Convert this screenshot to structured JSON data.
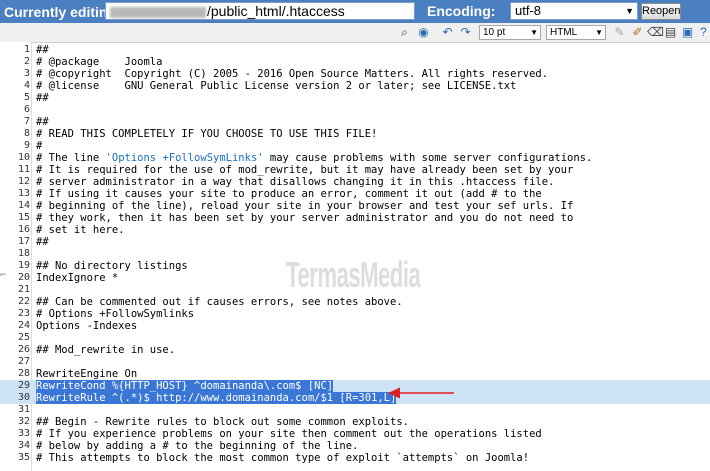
{
  "header": {
    "editing_label": "Currently editing:",
    "path_value": "/public_html/.htaccess",
    "encoding_label": "Encoding:",
    "encoding_value": "utf-8",
    "reopen_label": "Reopen"
  },
  "toolbar": {
    "font_size_value": "10 pt",
    "syntax_value": "HTML"
  },
  "watermark": "TermasMedia",
  "editor": {
    "lines": [
      {
        "n": "1",
        "code": "##"
      },
      {
        "n": "2",
        "code": "# @package    Joomla"
      },
      {
        "n": "3",
        "code": "# @copyright  Copyright (C) 2005 - 2016 Open Source Matters. All rights reserved."
      },
      {
        "n": "4",
        "code": "# @license    GNU General Public License version 2 or later; see LICENSE.txt"
      },
      {
        "n": "5",
        "code": "##"
      },
      {
        "n": "6",
        "code": ""
      },
      {
        "n": "7",
        "code": "##"
      },
      {
        "n": "8",
        "code": "# READ THIS COMPLETELY IF YOU CHOOSE TO USE THIS FILE!"
      },
      {
        "n": "9",
        "code": "#"
      },
      {
        "n": "10",
        "code": "# The line ",
        "str": "'Options +FollowSymLinks'",
        "rest": " may cause problems with some server configurations."
      },
      {
        "n": "11",
        "code": "# It is required for the use of mod_rewrite, but it may have already been set by your"
      },
      {
        "n": "12",
        "code": "# server administrator in a way that disallows changing it in this .htaccess file."
      },
      {
        "n": "13",
        "code": "# If using it causes your site to produce an error, comment it out (add # to the"
      },
      {
        "n": "14",
        "code": "# beginning of the line), reload your site in your browser and test your sef urls. If"
      },
      {
        "n": "15",
        "code": "# they work, then it has been set by your server administrator and you do not need to"
      },
      {
        "n": "16",
        "code": "# set it here."
      },
      {
        "n": "17",
        "code": "##"
      },
      {
        "n": "18",
        "code": ""
      },
      {
        "n": "19",
        "code": "## No directory listings"
      },
      {
        "n": "20",
        "code": "IndexIgnore *"
      },
      {
        "n": "21",
        "code": ""
      },
      {
        "n": "22",
        "code": "## Can be commented out if causes errors, see notes above."
      },
      {
        "n": "23",
        "code": "# Options +FollowSymlinks"
      },
      {
        "n": "24",
        "code": "Options -Indexes"
      },
      {
        "n": "25",
        "code": ""
      },
      {
        "n": "26",
        "code": "## Mod_rewrite in use."
      },
      {
        "n": "27",
        "code": ""
      },
      {
        "n": "28",
        "code": "RewriteEngine On"
      },
      {
        "n": "29",
        "code": "RewriteCond %{HTTP_HOST} ^domainanda\\.com$ [NC]",
        "selected": true
      },
      {
        "n": "30",
        "code": "RewriteRule ^(.*)$ http://www.domainanda.com/$1 [R=301,L]",
        "selected": true
      },
      {
        "n": "31",
        "code": ""
      },
      {
        "n": "32",
        "code": "## Begin - Rewrite rules to block out some common exploits."
      },
      {
        "n": "33",
        "code": "# If you experience problems on your site then comment out the operations listed"
      },
      {
        "n": "34",
        "code": "# below by adding a # to the beginning of the line."
      },
      {
        "n": "35",
        "code": "# This attempts to block the most common type of exploit `attempts` on Joomla!"
      }
    ]
  },
  "colors": {
    "header_bg": "#4a7fc1",
    "selection": "#3a76d6",
    "highlight_row": "#cfe3f7",
    "arrow": "#e02020"
  }
}
